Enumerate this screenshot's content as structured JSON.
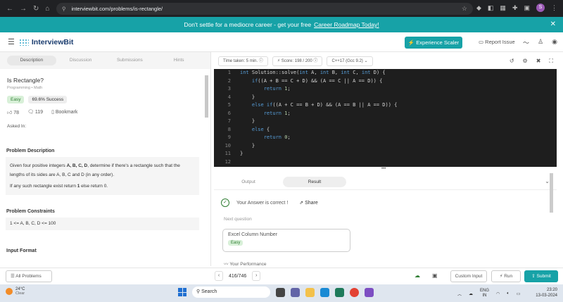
{
  "browser": {
    "url": "interviewbit.com/problems/is-rectangle/",
    "profile_initial": "S"
  },
  "banner": {
    "text": "Don't settle for a mediocre career - get your free",
    "link": "Career Roadmap Today!"
  },
  "header": {
    "brand": "InterviewBit",
    "experience": "⚡ Experience Scaler",
    "report": "Report Issue"
  },
  "tabs": [
    "Description",
    "Discussion",
    "Submissions",
    "Hints"
  ],
  "problem": {
    "title": "Is Rectangle?",
    "category": "Programming • Math",
    "difficulty": "Easy",
    "success": "69.6% Success",
    "likes": "78",
    "comments": "119",
    "bookmark": "Bookmark",
    "asked": "Asked In:"
  },
  "description": {
    "heading": "Problem Description",
    "p1_a": "Given four positive integers ",
    "p1_b": "A, B, C, D",
    "p1_c": ", determine if there's a rectangle such that the lengths of its sides are A, B, C and D (in any order).",
    "p2_a": "If any such rectangle exist return ",
    "p2_b": "1",
    "p2_c": " else return 0."
  },
  "constraints": {
    "heading": "Problem Constraints",
    "text": "1 <= A, B, C, D <= 100"
  },
  "input_format": {
    "heading": "Input Format"
  },
  "editor": {
    "time": "Time taken: 5 min.",
    "score": "Score: 198 / 200",
    "lang": "C++17 (Gcc 9.2)"
  },
  "output": {
    "tab_output": "Output",
    "tab_result": "Result",
    "correct": "Your Answer is correct !",
    "share": "Share",
    "next": "Next question",
    "next_title": "Excel Column Number",
    "next_diff": "Easy",
    "performance": "Your Performance"
  },
  "bottom": {
    "all": "All Problems",
    "page": "416/746",
    "custom": "Custom Input",
    "run": "Run",
    "submit": "Submit"
  },
  "taskbar": {
    "temp": "24°C",
    "cond": "Clear",
    "search": "Search",
    "lang1": "ENG",
    "lang2": "IN",
    "time": "23:20",
    "date": "13-03-2024"
  }
}
